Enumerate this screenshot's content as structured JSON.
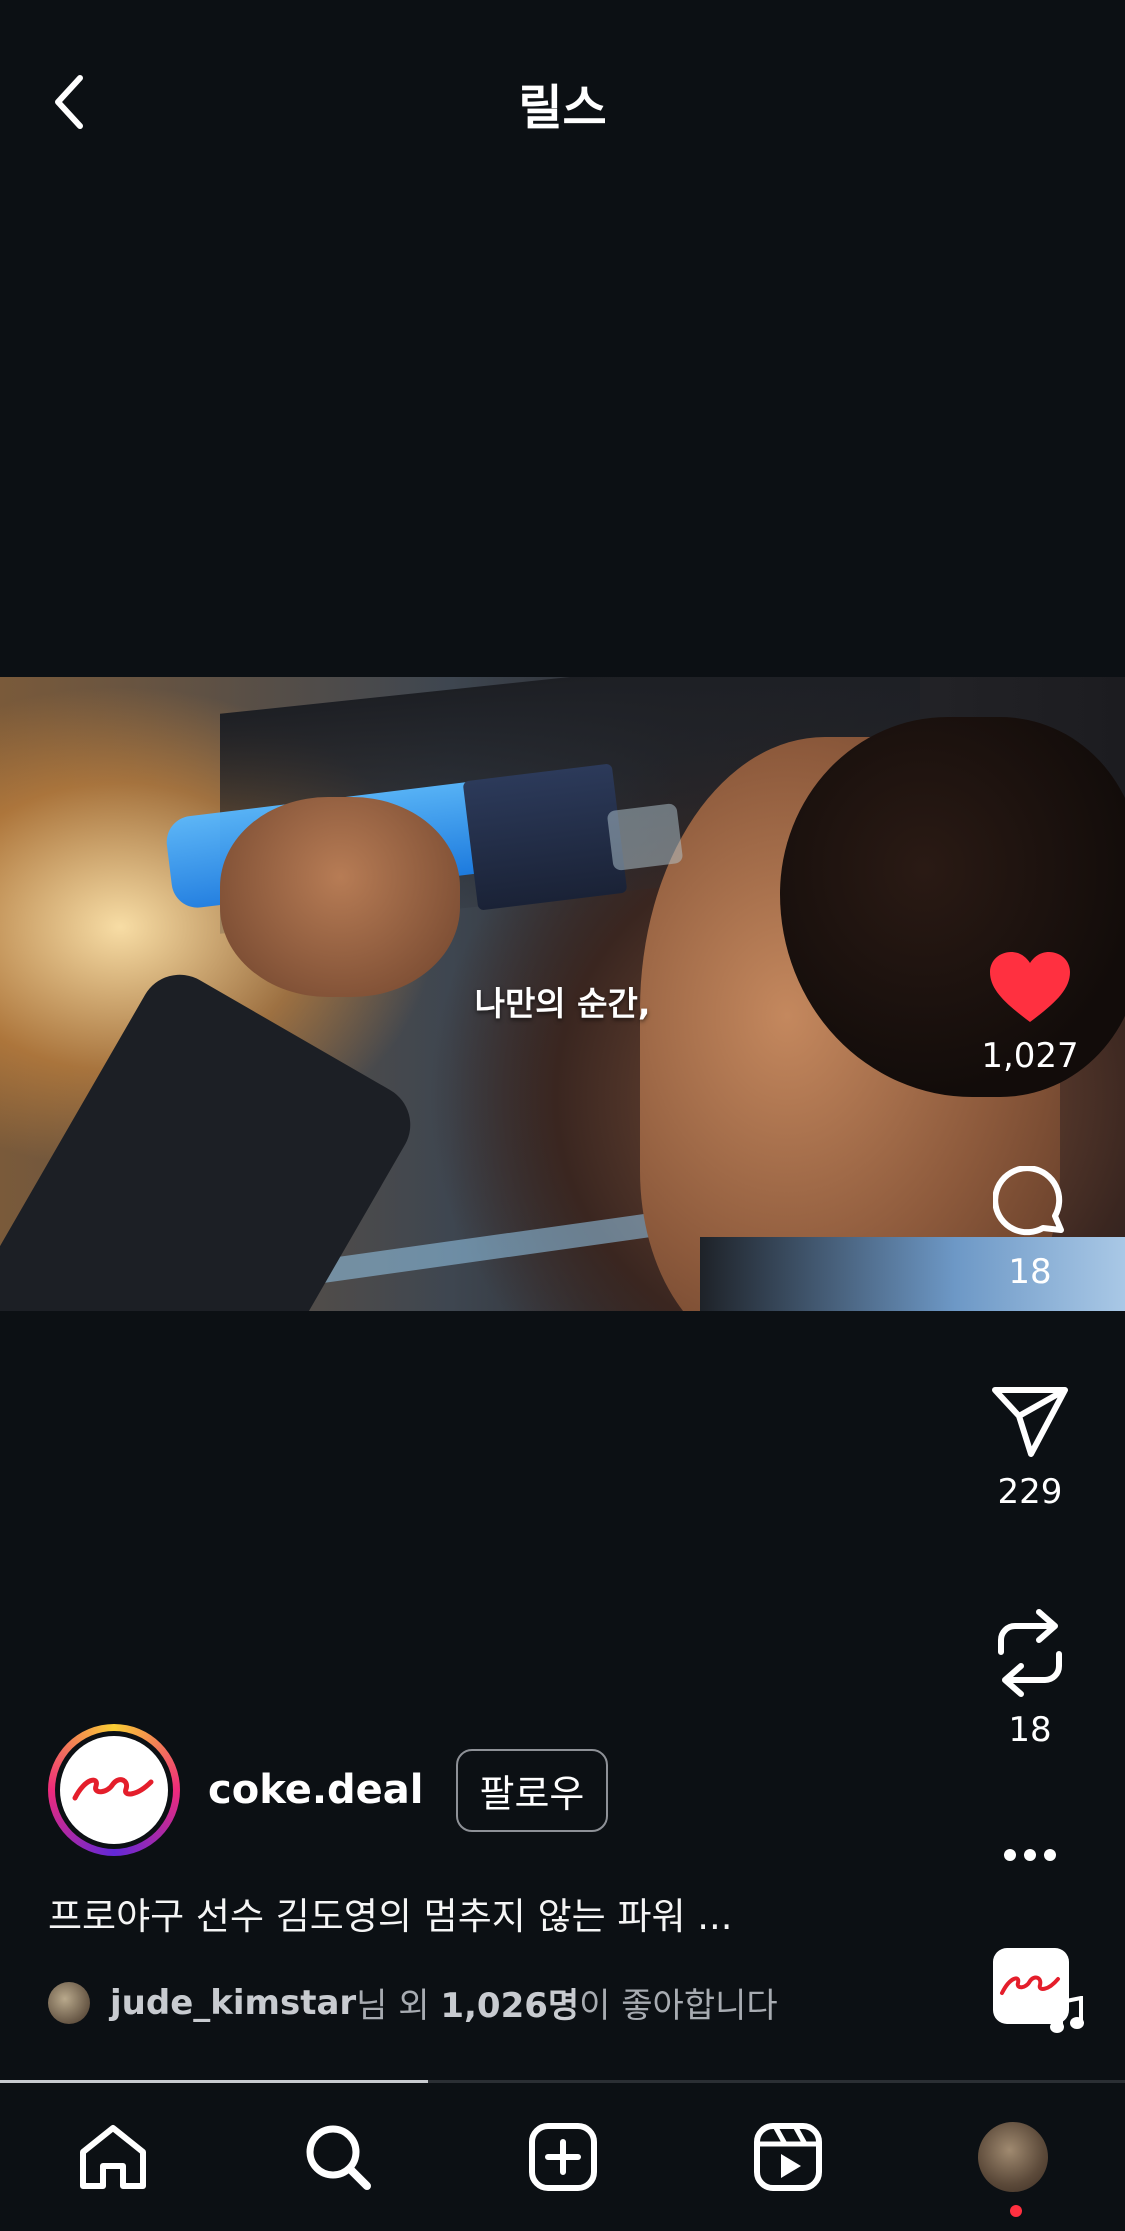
{
  "header": {
    "title": "릴스"
  },
  "video": {
    "subtitle": "나만의 순간,"
  },
  "actions": {
    "like_count": "1,027",
    "comment_count": "18",
    "share_count": "229",
    "repost_count": "18"
  },
  "author": {
    "username": "coke.deal",
    "follow_label": "팔로우"
  },
  "caption": "프로야구 선수 김도영의 멈추지 않는 파워 ...",
  "likes": {
    "user": "jude_kimstar",
    "mid": "님 외 ",
    "count": "1,026명",
    "suffix": "이 좋아합니다"
  },
  "progress": {
    "fraction": 0.38
  },
  "colors": {
    "background": "#0c1014",
    "like_red": "#ff3040"
  },
  "icons": {
    "back": "chevron-left-icon",
    "like": "heart-filled-icon",
    "comment": "comment-bubble-icon",
    "share": "paper-plane-icon",
    "repost": "repost-icon",
    "more": "more-horizontal-icon",
    "home": "home-icon",
    "search": "search-icon",
    "create": "create-post-icon",
    "reels": "reels-icon"
  }
}
